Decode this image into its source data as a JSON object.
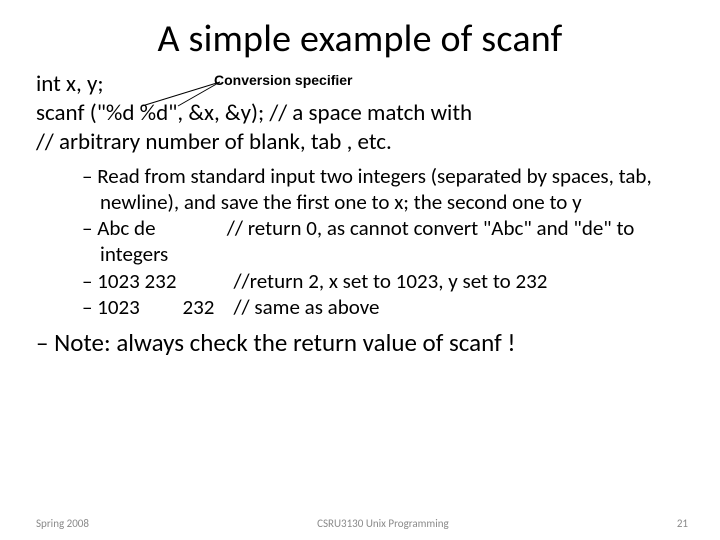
{
  "title": "A simple example of scanf",
  "label": "Conversion specifier",
  "code": {
    "l1": "int x, y;",
    "l2": "scanf (\"%d  %d\", &x, &y);  // a space match with",
    "l3": "// arbitrary number of blank, tab , etc."
  },
  "bullets": {
    "b1": "Read from standard input two integers (separated by spaces, tab, newline), and save the first one to x; the second one to y",
    "b2": "Abc de               // return 0, as cannot convert \"Abc\" and \"de\" to integers",
    "b3": "1023 232            //return 2, x set to 1023, y set to 232",
    "b4": "1023         232    // same as above"
  },
  "note": "Note: always check the return value of scanf !",
  "footer": {
    "left": "Spring 2008",
    "center": "CSRU3130 Unix Programming",
    "right": "21"
  }
}
